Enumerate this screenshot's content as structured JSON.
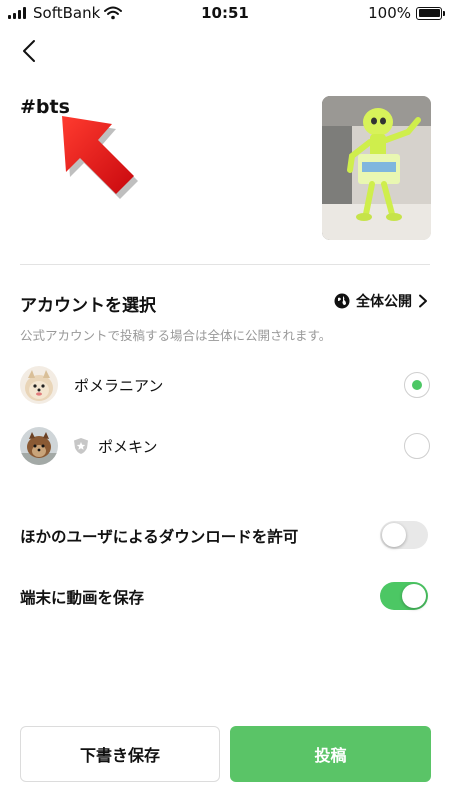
{
  "status_bar": {
    "carrier": "SoftBank",
    "time": "10:51",
    "battery_text": "100%",
    "battery_level": 1.0
  },
  "header": {
    "back_icon": "chevron-left-icon"
  },
  "post": {
    "caption": "#bts",
    "annotation_icon": "red-arrow-icon",
    "thumbnail_icon": "video-thumbnail"
  },
  "account_section": {
    "title": "アカウントを選択",
    "visibility_label": "全体公開",
    "visibility_icon": "globe-icon",
    "note": "公式アカウントで投稿する場合は全体に公開されます。",
    "accounts": [
      {
        "name": "ポメラニアン",
        "selected": true,
        "badge": ""
      },
      {
        "name": "ポメキン",
        "selected": false,
        "badge": "shield-star-icon"
      }
    ]
  },
  "settings": {
    "allow_download": {
      "label": "ほかのユーザによるダウンロードを許可",
      "on": false
    },
    "save_to_device": {
      "label": "端末に動画を保存",
      "on": true
    }
  },
  "footer": {
    "draft_label": "下書き保存",
    "post_label": "投稿"
  },
  "colors": {
    "accent": "#4cc764",
    "post_button": "#5ac467",
    "annotation_arrow": "#e3151a"
  }
}
